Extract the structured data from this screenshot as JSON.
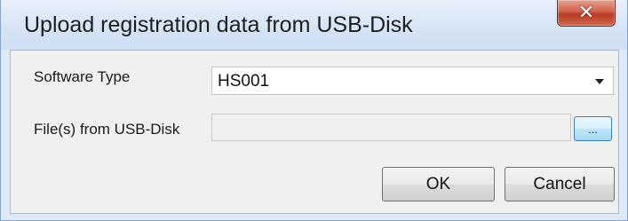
{
  "window": {
    "title": "Upload registration data from USB-Disk",
    "close_icon": "close-icon"
  },
  "form": {
    "software_type_label": "Software Type",
    "software_type_value": "HS001",
    "files_label": "File(s) from USB-Disk",
    "files_value": "",
    "browse_label": "..."
  },
  "buttons": {
    "ok": "OK",
    "cancel": "Cancel"
  },
  "colors": {
    "title_bar": "#d6e4f5",
    "close_button": "#c94a36",
    "client_background": "#f0f0f0"
  }
}
